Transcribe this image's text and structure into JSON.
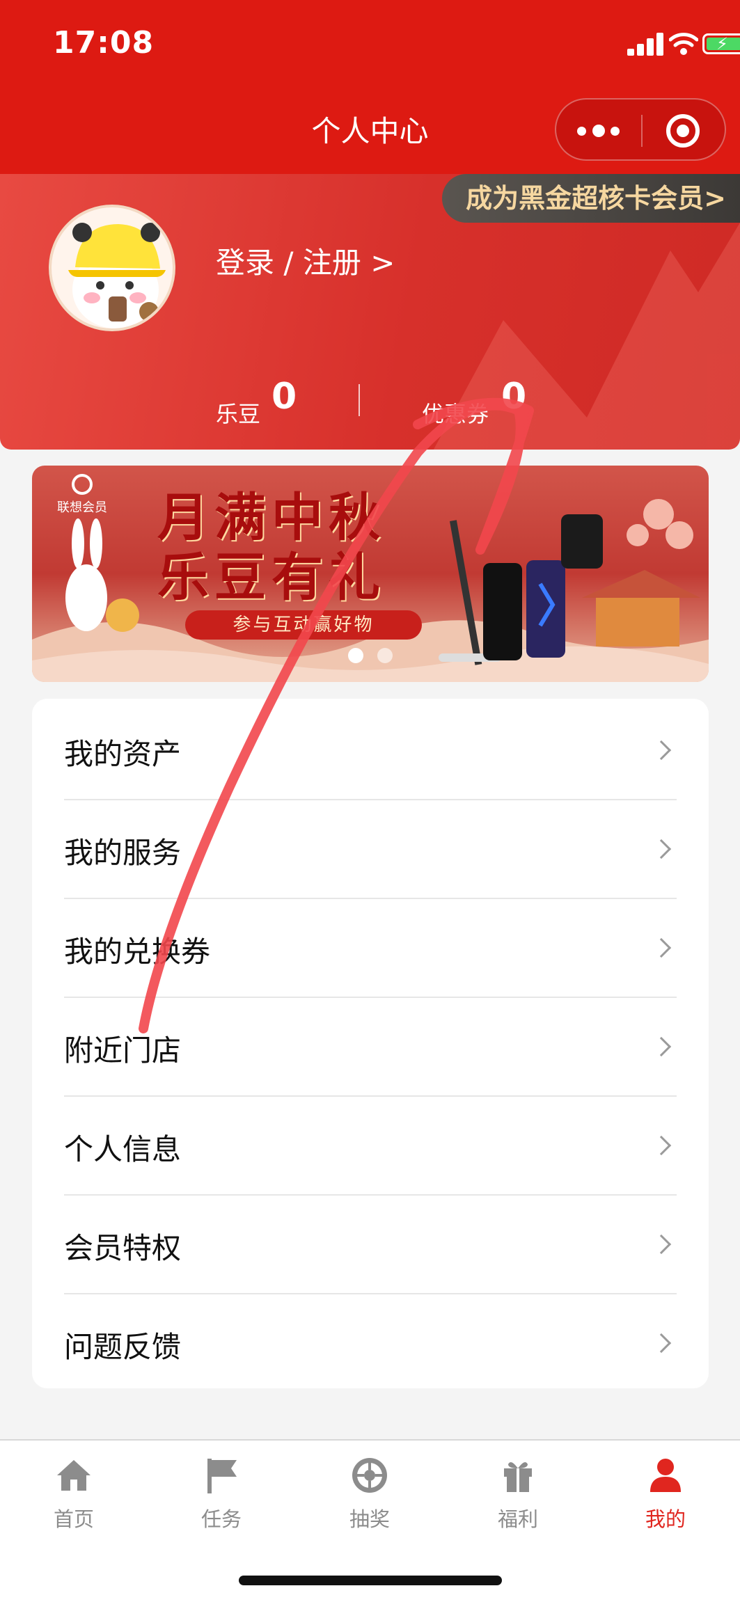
{
  "status_bar": {
    "time": "17:08"
  },
  "nav": {
    "title": "个人中心"
  },
  "profile": {
    "member_badge": "成为黑金超核卡会员>",
    "login_link": "登录 / 注册 >",
    "stats": [
      {
        "label": "乐豆",
        "value": "0"
      },
      {
        "label": "优惠券",
        "value": "0"
      }
    ]
  },
  "banner": {
    "brand": "联想会员",
    "title_line1": "月满中秋",
    "title_line2": "乐豆有礼",
    "subtitle": "参与互动赢好物",
    "dots": 2,
    "active_dot": 0
  },
  "menu": {
    "items": [
      {
        "label": "我的资产"
      },
      {
        "label": "我的服务"
      },
      {
        "label": "我的兑换券"
      },
      {
        "label": "附近门店"
      },
      {
        "label": "个人信息"
      },
      {
        "label": "会员特权"
      },
      {
        "label": "问题反馈"
      }
    ]
  },
  "tabbar": {
    "items": [
      {
        "label": "首页",
        "icon": "home-icon"
      },
      {
        "label": "任务",
        "icon": "flag-icon"
      },
      {
        "label": "抽奖",
        "icon": "prize-wheel-icon"
      },
      {
        "label": "福利",
        "icon": "gift-icon"
      },
      {
        "label": "我的",
        "icon": "person-icon"
      }
    ],
    "active_index": 4
  },
  "colors": {
    "brand_red": "#dd1a12",
    "active_tab": "#e0261f",
    "badge_gold": "#f6d7a0",
    "inactive_tab": "#8c8c8c"
  }
}
